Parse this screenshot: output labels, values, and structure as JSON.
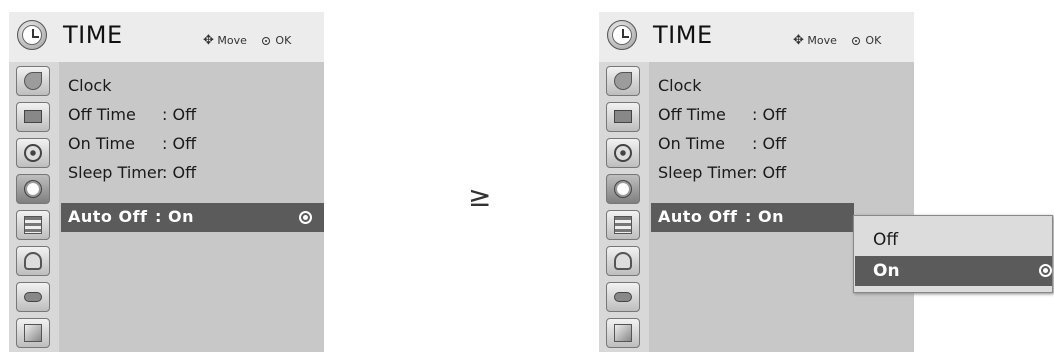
{
  "left_menu": {
    "title": "TIME",
    "hint_move": "Move",
    "hint_ok": "OK",
    "items": [
      {
        "label": "Clock",
        "value": ""
      },
      {
        "label": "Off Time",
        "value": ": Off"
      },
      {
        "label": "On Time",
        "value": ": Off"
      },
      {
        "label": "Sleep Timer",
        "value": ": Off"
      }
    ],
    "selected": {
      "label": "Auto Off",
      "value": ": On"
    }
  },
  "arrow_glyph": "≥",
  "right_menu": {
    "title": "TIME",
    "hint_move": "Move",
    "hint_ok": "OK",
    "items": [
      {
        "label": "Clock",
        "value": ""
      },
      {
        "label": "Off Time",
        "value": ": Off"
      },
      {
        "label": "On Time",
        "value": ": Off"
      },
      {
        "label": "Sleep Timer",
        "value": ": Off"
      }
    ],
    "selected": {
      "label": "Auto Off",
      "value": ": On"
    },
    "submenu": {
      "options": [
        "Off",
        "On"
      ],
      "selected": "On"
    }
  },
  "icons": [
    "antenna-icon",
    "picture-icon",
    "audio-icon",
    "time-icon",
    "option-icon",
    "lock-icon",
    "input-icon",
    "usb-icon"
  ],
  "colors": {
    "panel": "#c8c8c8",
    "selected_row": "#5b5b5b",
    "header": "#ececec"
  }
}
